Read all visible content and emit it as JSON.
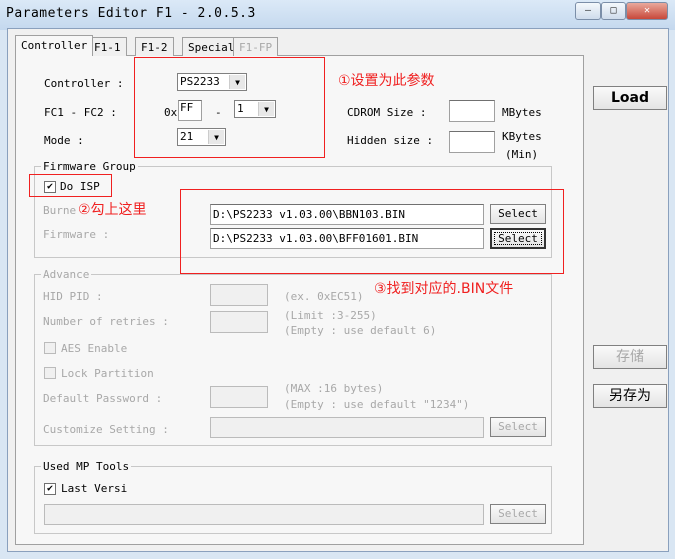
{
  "window": {
    "title": "Parameters Editor F1 - 2.0.5.3",
    "minimize": "—",
    "maximize": "□",
    "close": "✕"
  },
  "tabs": [
    "Controller",
    "F1-1",
    "F1-2",
    "Special",
    "F1-FP"
  ],
  "controller": {
    "label": "Controller :",
    "value": "PS2233"
  },
  "fc": {
    "label": "FC1 - FC2 :",
    "prefix": "0x",
    "fc1": "FF",
    "dash": "-",
    "fc2": "1"
  },
  "mode": {
    "label": "Mode :",
    "value": "21"
  },
  "cdrom": {
    "label": "CDROM Size :",
    "value": "",
    "unit": "MBytes"
  },
  "hidden": {
    "label": "Hidden size :",
    "value": "",
    "unit": "KBytes",
    "unit2": "(Min)"
  },
  "firmware_group": {
    "title": "Firmware Group",
    "do_isp": "Do ISP",
    "do_isp_checked": true,
    "burner_label": "Burner :",
    "burner_value": "D:\\PS2233 v1.03.00\\BBN103.BIN",
    "firmware_label": "Firmware :",
    "firmware_value": "D:\\PS2233 v1.03.00\\BFF01601.BIN",
    "select": "Select"
  },
  "advance": {
    "title": "Advance",
    "hid_label": "HID PID :",
    "hid_hint": "(ex. 0xEC51)",
    "retries_label": "Number of retries :",
    "retries_hint1": "(Limit :3-255)",
    "retries_hint2": "(Empty : use default 6)",
    "aes": "AES Enable",
    "lock": "Lock Partition",
    "pwd_label": "Default Password :",
    "pwd_hint1": "(MAX :16 bytes)",
    "pwd_hint2": "(Empty : use default \"1234\")",
    "custom_label": "Customize Setting :",
    "select": "Select"
  },
  "used_mp": {
    "title": "Used MP Tools",
    "last": "Last Versi",
    "last_checked": true,
    "select": "Select"
  },
  "buttons": {
    "load": "Load",
    "save": "存储",
    "save_as": "另存为"
  },
  "annotations": {
    "note1": "①设置为此参数",
    "note2": "②勾上这里",
    "note3": "③找到对应的.BIN文件"
  }
}
